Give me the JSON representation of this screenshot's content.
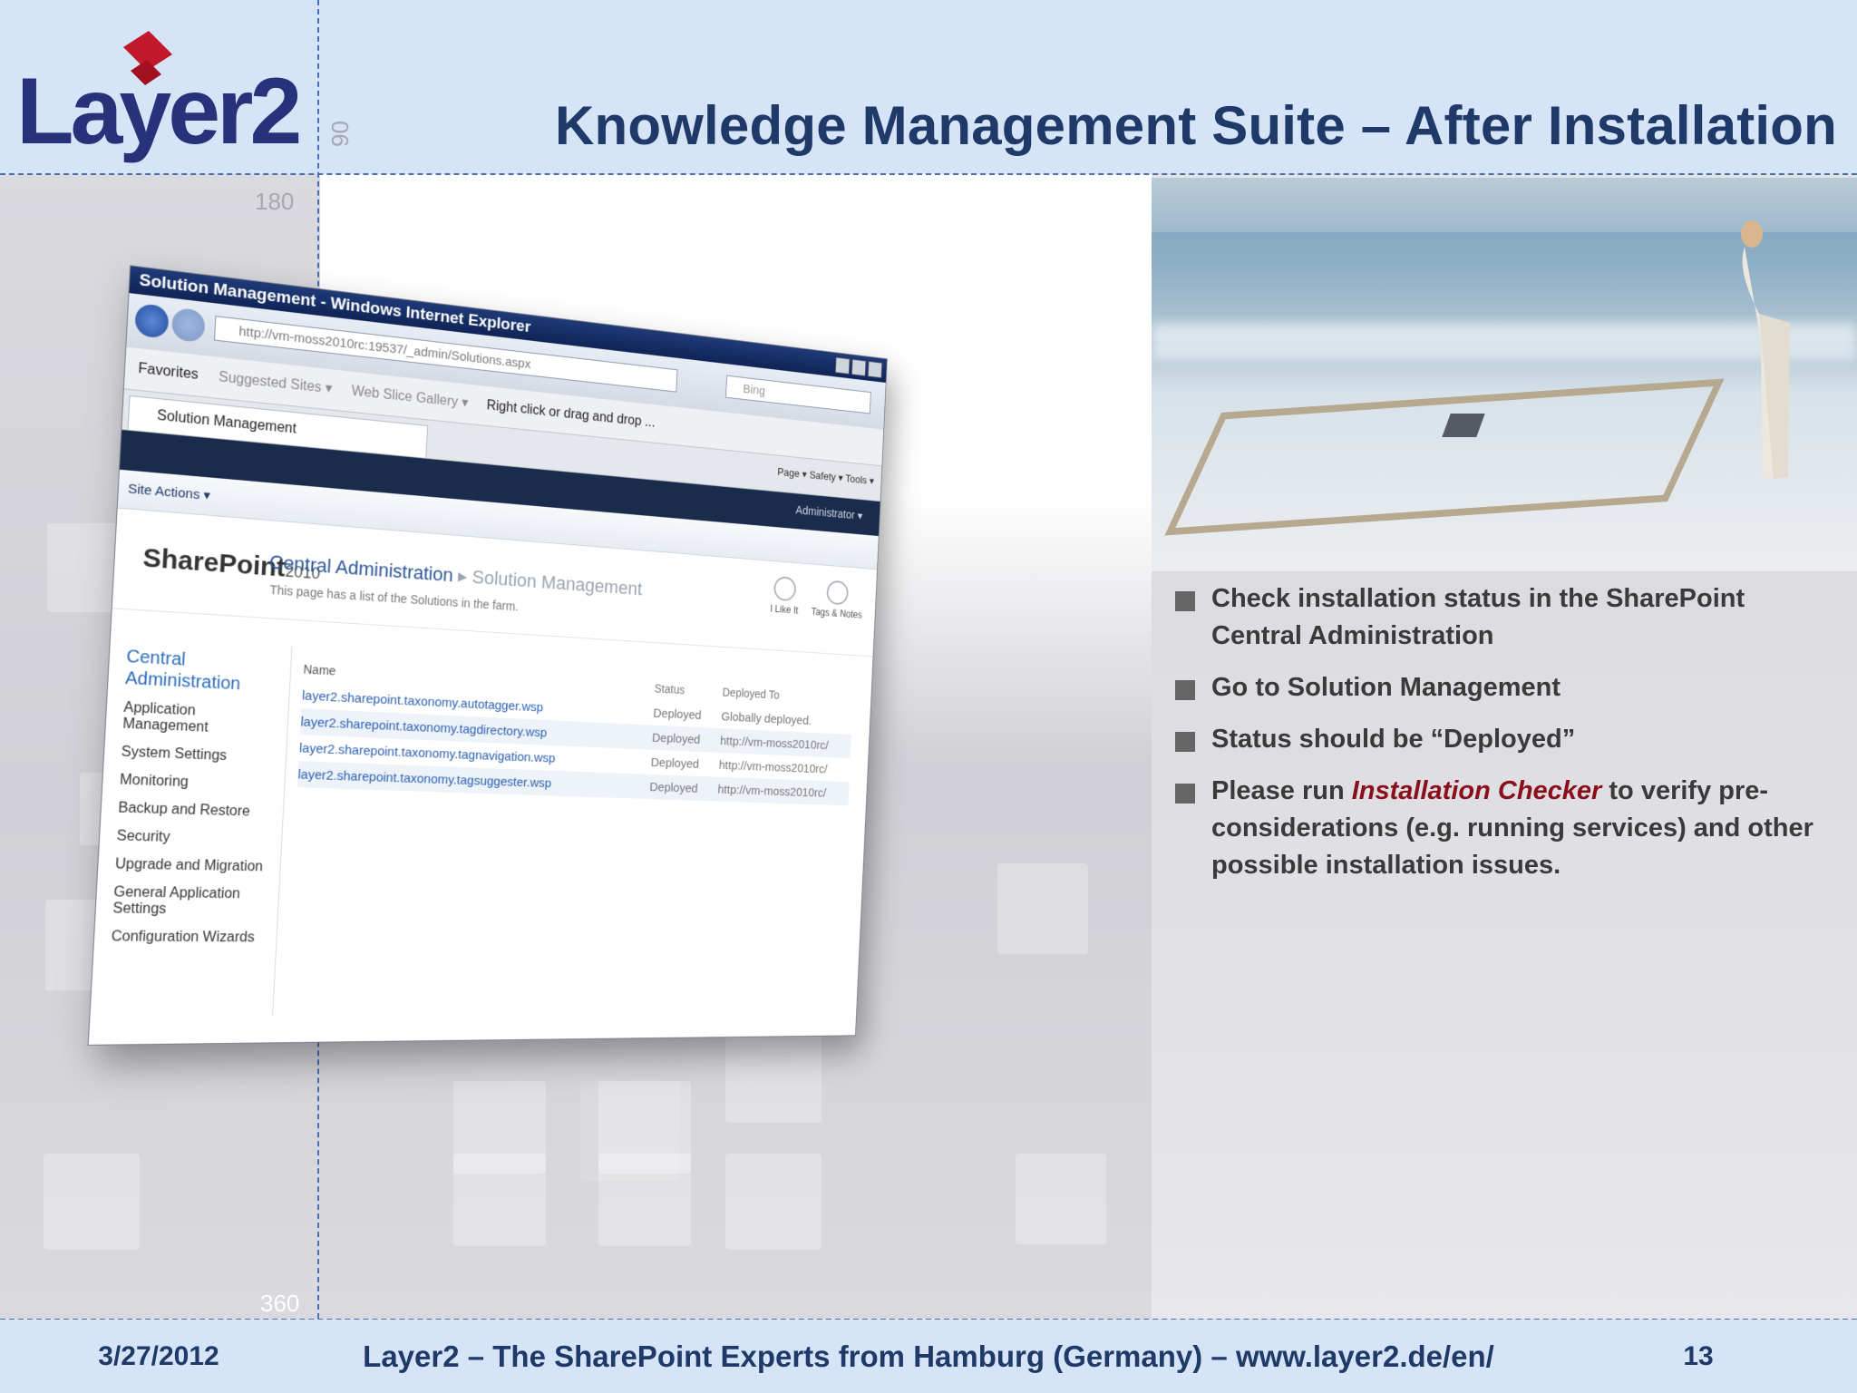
{
  "slide": {
    "title": "Knowledge Management Suite – After Installation",
    "guides": {
      "g90": "90",
      "g180": "180",
      "g360": "360"
    }
  },
  "logo": {
    "text": "Layer2"
  },
  "browser": {
    "window_title": "Solution Management - Windows Internet Explorer",
    "url": "http://vm-moss2010rc:19537/_admin/Solutions.aspx",
    "search_placeholder": "Bing",
    "favorites": "Favorites",
    "suggested_sites": "Suggested Sites ▾",
    "web_slice_gallery": "Web Slice Gallery ▾",
    "right_click_hint": "Right click or drag and drop ...",
    "tab_label": "Solution Management",
    "command_bar": "Page ▾  Safety ▾  Tools ▾",
    "admin_menu": "Administrator ▾",
    "site_actions": "Site Actions ▾",
    "sp_logo": "SharePoint",
    "sp_logo_version": "2010",
    "breadcrumb_root": "Central Administration",
    "breadcrumb_sep": " ▸ ",
    "breadcrumb_current": "Solution Management",
    "page_description": "This page has a list of the Solutions in the farm.",
    "header_icons": [
      "I Like It",
      "Tags & Notes"
    ],
    "quick_launch": {
      "head": "Central Administration",
      "items": [
        "Application Management",
        "System Settings",
        "Monitoring",
        "Backup and Restore",
        "Security",
        "Upgrade and Migration",
        "General Application Settings",
        "Configuration Wizards"
      ]
    },
    "table": {
      "headers": [
        "Name",
        "Status",
        "Deployed To"
      ],
      "rows": [
        [
          "layer2.sharepoint.taxonomy.autotagger.wsp",
          "Deployed",
          "Globally deployed."
        ],
        [
          "layer2.sharepoint.taxonomy.tagdirectory.wsp",
          "Deployed",
          "http://vm-moss2010rc/"
        ],
        [
          "layer2.sharepoint.taxonomy.tagnavigation.wsp",
          "Deployed",
          "http://vm-moss2010rc/"
        ],
        [
          "layer2.sharepoint.taxonomy.tagsuggester.wsp",
          "Deployed",
          "http://vm-moss2010rc/"
        ]
      ]
    }
  },
  "bullets": {
    "b1": "Check installation status in the SharePoint Central Administration",
    "b2": "Go to Solution Management",
    "b3": "Status should be “Deployed”",
    "b4_pre": "Please run ",
    "b4_highlight": "Installation Checker",
    "b4_post": " to verify pre-considerations (e.g. running services) and other possible installation issues."
  },
  "footer": {
    "date": "3/27/2012",
    "center": "Layer2 – The SharePoint Experts from Hamburg (Germany) – www.layer2.de/en/",
    "page_number": "13"
  },
  "colors": {
    "title": "#1f3a68",
    "band": "#d6e4f7",
    "highlight": "#8a0f1a",
    "guide_line": "#4a6fb8"
  }
}
